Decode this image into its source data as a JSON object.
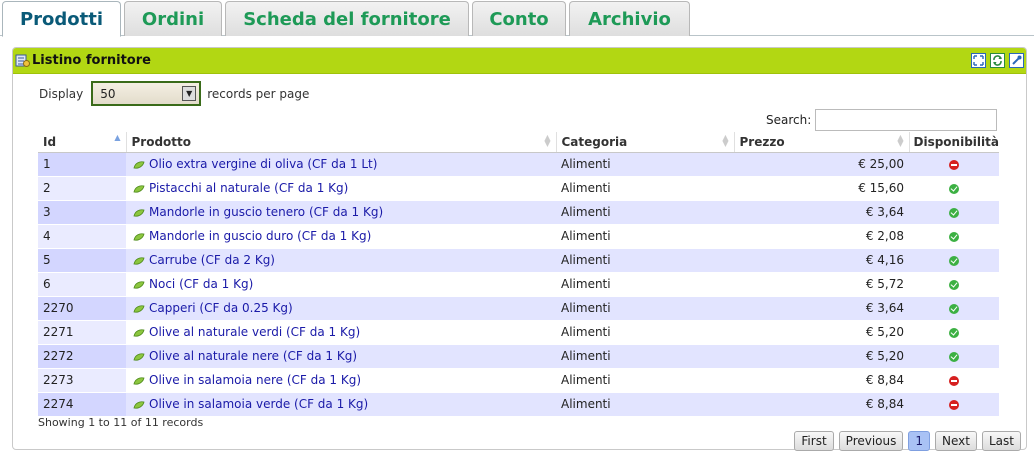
{
  "tabs": [
    {
      "label": "Prodotti",
      "active": true
    },
    {
      "label": "Ordini",
      "active": false
    },
    {
      "label": "Scheda del fornitore",
      "active": false
    },
    {
      "label": "Conto",
      "active": false
    },
    {
      "label": "Archivio",
      "active": false
    }
  ],
  "panel": {
    "title": "Listino fornitore",
    "header_icons": [
      "expand-icon",
      "refresh-icon",
      "settings-icon"
    ]
  },
  "length": {
    "label_before": "Display",
    "value": "50",
    "label_after": "records per page"
  },
  "search": {
    "label": "Search:",
    "value": ""
  },
  "columns": [
    "Id",
    "Prodotto",
    "Categoria",
    "Prezzo",
    "Disponibilità"
  ],
  "rows": [
    {
      "id": "1",
      "product": "Olio extra vergine di oliva (CF da 1 Lt)",
      "category": "Alimenti",
      "price": "€ 25,00",
      "available": false
    },
    {
      "id": "2",
      "product": "Pistacchi al naturale (CF da 1 Kg)",
      "category": "Alimenti",
      "price": "€ 15,60",
      "available": true
    },
    {
      "id": "3",
      "product": "Mandorle in guscio tenero (CF da 1 Kg)",
      "category": "Alimenti",
      "price": "€ 3,64",
      "available": true
    },
    {
      "id": "4",
      "product": "Mandorle in guscio duro (CF da 1 Kg)",
      "category": "Alimenti",
      "price": "€ 2,08",
      "available": true
    },
    {
      "id": "5",
      "product": "Carrube (CF da 2 Kg)",
      "category": "Alimenti",
      "price": "€ 4,16",
      "available": true
    },
    {
      "id": "6",
      "product": "Noci (CF da 1 Kg)",
      "category": "Alimenti",
      "price": "€ 5,72",
      "available": true
    },
    {
      "id": "2270",
      "product": "Capperi (CF da 0.25 Kg)",
      "category": "Alimenti",
      "price": "€ 3,64",
      "available": true
    },
    {
      "id": "2271",
      "product": "Olive al naturale verdi (CF da 1 Kg)",
      "category": "Alimenti",
      "price": "€ 5,20",
      "available": true
    },
    {
      "id": "2272",
      "product": "Olive al naturale nere (CF da 1 Kg)",
      "category": "Alimenti",
      "price": "€ 5,20",
      "available": true
    },
    {
      "id": "2273",
      "product": "Olive in salamoia nere (CF da 1 Kg)",
      "category": "Alimenti",
      "price": "€ 8,84",
      "available": false
    },
    {
      "id": "2274",
      "product": "Olive in salamoia verde (CF da 1 Kg)",
      "category": "Alimenti",
      "price": "€ 8,84",
      "available": false
    }
  ],
  "info": "Showing 1 to 11 of 11 records",
  "pager": {
    "first": "First",
    "previous": "Previous",
    "page": "1",
    "next": "Next",
    "last": "Last"
  },
  "colors": {
    "accent_green": "#b2d713",
    "tab_text": "#1e9a57",
    "active_tab_text": "#0a5a78",
    "row_odd": "#e2e4ff",
    "link": "#1a1aa8",
    "available": "#3cb043",
    "unavailable": "#d62020"
  }
}
